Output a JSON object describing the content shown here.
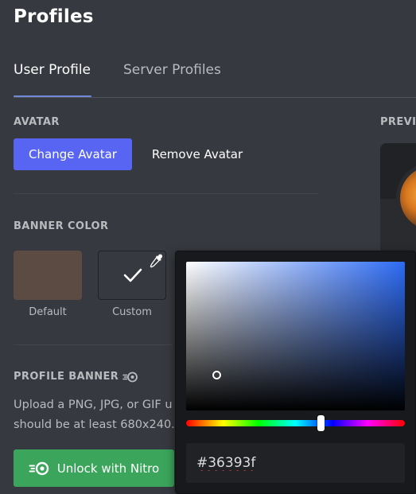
{
  "page": {
    "title": "Profiles"
  },
  "tabs": [
    {
      "label": "User Profile",
      "active": true
    },
    {
      "label": "Server Profiles",
      "active": false
    }
  ],
  "avatar": {
    "section_label": "AVATAR",
    "change_label": "Change Avatar",
    "remove_label": "Remove Avatar"
  },
  "banner_color": {
    "section_label": "BANNER COLOR",
    "default_caption": "Default",
    "custom_caption": "Custom",
    "default_color": "#5c4b42"
  },
  "profile_banner": {
    "section_label": "PROFILE BANNER",
    "description_line1": "Upload a PNG, JPG, or GIF u",
    "description_line2": "should be at least 680x240.",
    "nitro_button_label": "Unlock with Nitro"
  },
  "preview": {
    "section_label": "PREVI"
  },
  "color_picker": {
    "hex_value": "#36393f",
    "hue_position": 0.62
  },
  "colors": {
    "accent": "#5865f2",
    "nitro_green": "#3ba55c",
    "tab_underline": "#7289da",
    "background": "#36393f"
  },
  "icons": {
    "custom_swatch_check": "checkmark-icon",
    "custom_swatch_picker": "eyedropper-icon",
    "section_nitro": "nitro-icon",
    "button_nitro": "nitro-icon"
  }
}
